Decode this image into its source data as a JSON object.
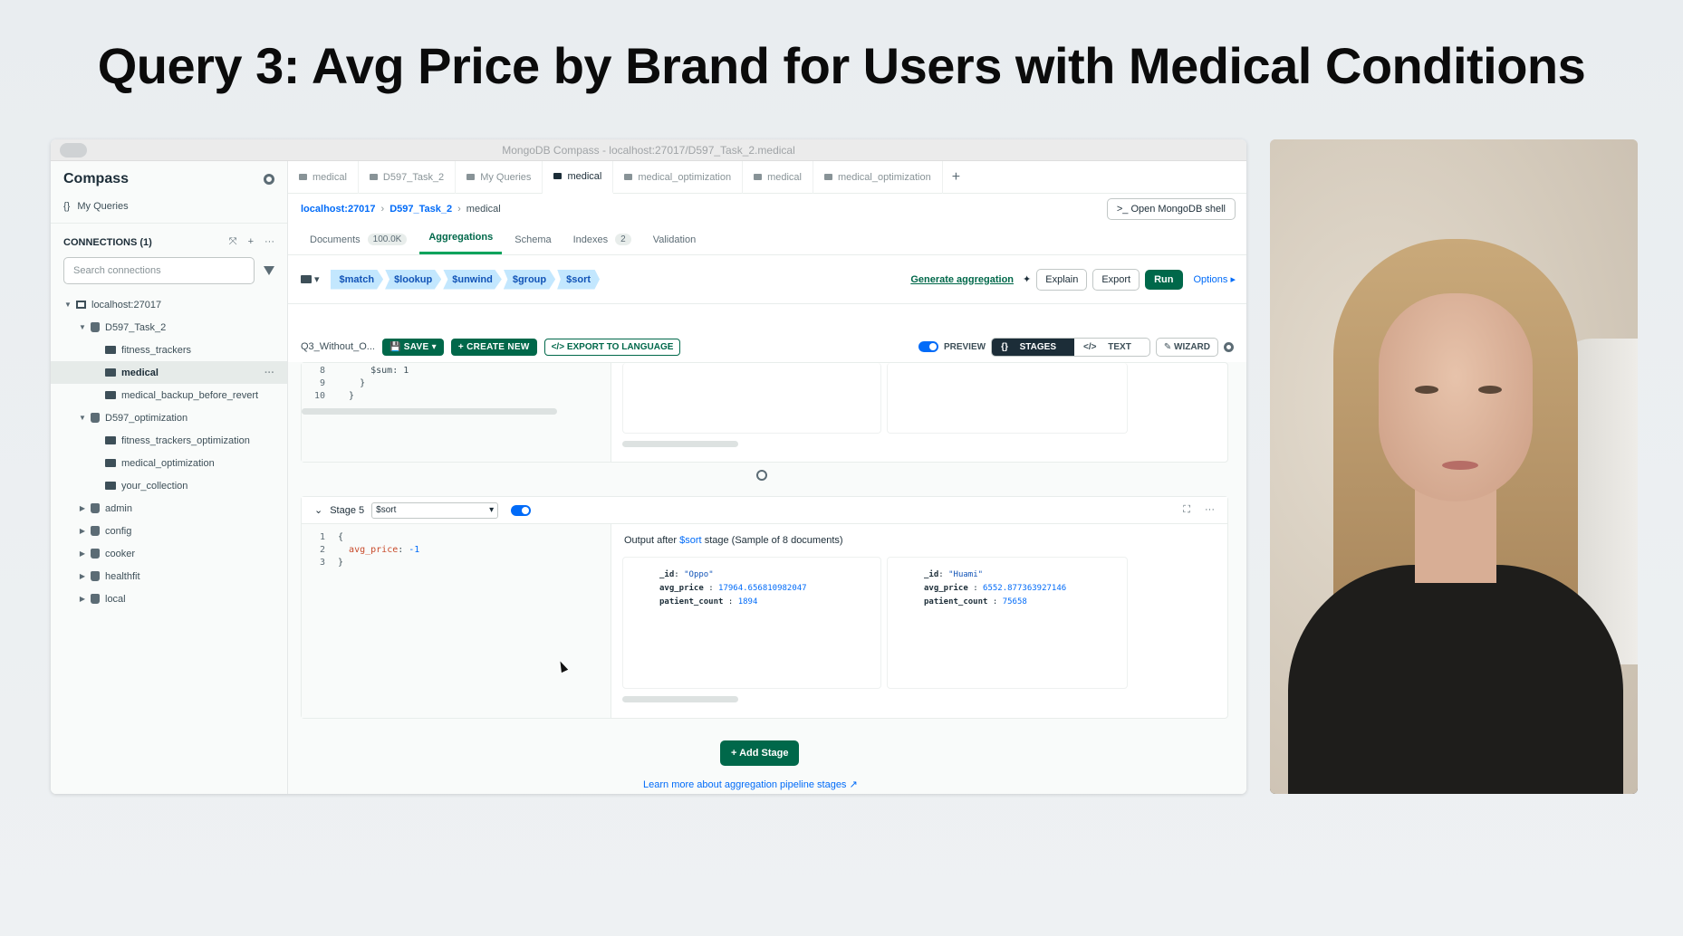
{
  "slide": {
    "title": "Query 3: Avg Price by Brand for Users with Medical Conditions"
  },
  "window": {
    "title": "MongoDB Compass - localhost:27017/D597_Task_2.medical"
  },
  "sidebar": {
    "brand": "Compass",
    "my_queries": "My Queries",
    "connections_label": "CONNECTIONS (1)",
    "search_placeholder": "Search connections",
    "tree": [
      {
        "label": "localhost:27017",
        "level": 0,
        "kind": "host",
        "caret": "▼"
      },
      {
        "label": "D597_Task_2",
        "level": 1,
        "kind": "db",
        "caret": "▼"
      },
      {
        "label": "fitness_trackers",
        "level": 2,
        "kind": "coll",
        "caret": ""
      },
      {
        "label": "medical",
        "level": 2,
        "kind": "coll",
        "caret": "",
        "selected": true
      },
      {
        "label": "medical_backup_before_revert",
        "level": 2,
        "kind": "coll",
        "caret": ""
      },
      {
        "label": "D597_optimization",
        "level": 1,
        "kind": "db",
        "caret": "▼"
      },
      {
        "label": "fitness_trackers_optimization",
        "level": 2,
        "kind": "coll",
        "caret": ""
      },
      {
        "label": "medical_optimization",
        "level": 2,
        "kind": "coll",
        "caret": ""
      },
      {
        "label": "your_collection",
        "level": 2,
        "kind": "coll",
        "caret": ""
      },
      {
        "label": "admin",
        "level": 1,
        "kind": "db",
        "caret": "▶"
      },
      {
        "label": "config",
        "level": 1,
        "kind": "db",
        "caret": "▶"
      },
      {
        "label": "cooker",
        "level": 1,
        "kind": "db",
        "caret": "▶"
      },
      {
        "label": "healthfit",
        "level": 1,
        "kind": "db",
        "caret": "▶"
      },
      {
        "label": "local",
        "level": 1,
        "kind": "db",
        "caret": "▶"
      }
    ]
  },
  "tabs": [
    {
      "label": "medical",
      "active": false
    },
    {
      "label": "D597_Task_2",
      "active": false
    },
    {
      "label": "My Queries",
      "active": false
    },
    {
      "label": "medical",
      "active": true
    },
    {
      "label": "medical_optimization",
      "active": false
    },
    {
      "label": "medical",
      "active": false
    },
    {
      "label": "medical_optimization",
      "active": false
    }
  ],
  "breadcrumb": {
    "host": "localhost:27017",
    "db": "D597_Task_2",
    "coll": "medical"
  },
  "open_shell": "Open MongoDB shell",
  "subtabs": {
    "documents": "Documents",
    "documents_count": "100.0K",
    "aggregations": "Aggregations",
    "schema": "Schema",
    "indexes": "Indexes",
    "indexes_count": "2",
    "validation": "Validation"
  },
  "stage_chips": [
    "$match",
    "$lookup",
    "$unwind",
    "$group",
    "$sort"
  ],
  "toolbar": {
    "generate": "Generate aggregation",
    "explain": "Explain",
    "export": "Export",
    "run": "Run",
    "options": "Options"
  },
  "pipeline": {
    "name": "Q3_Without_O...",
    "save": "SAVE",
    "create_new": "CREATE NEW",
    "export_lang": "EXPORT TO LANGUAGE",
    "preview": "PREVIEW",
    "stages": "STAGES",
    "text": "TEXT",
    "wizard": "WIZARD"
  },
  "prev_stage_code": [
    {
      "n": "8",
      "text": "      $sum: 1"
    },
    {
      "n": "9",
      "text": "    }"
    },
    {
      "n": "10",
      "text": "  }"
    }
  ],
  "stage5": {
    "label": "Stage 5",
    "operator": "$sort",
    "code": [
      {
        "n": "1",
        "text": "{"
      },
      {
        "n": "2",
        "key": "avg_price",
        "val": "-1"
      },
      {
        "n": "3",
        "text": "}"
      }
    ],
    "output_prefix": "Output after",
    "output_op": "$sort",
    "output_suffix": "stage (Sample of 8 documents)",
    "docs": [
      {
        "id": "\"Oppo\"",
        "avg_price": "17964.656810982047",
        "patient_count": "1894"
      },
      {
        "id": "\"Huami\"",
        "avg_price": "6552.877363927146",
        "patient_count": "75658"
      }
    ]
  },
  "add_stage": "Add Stage",
  "learn_more": "Learn more about aggregation pipeline stages"
}
